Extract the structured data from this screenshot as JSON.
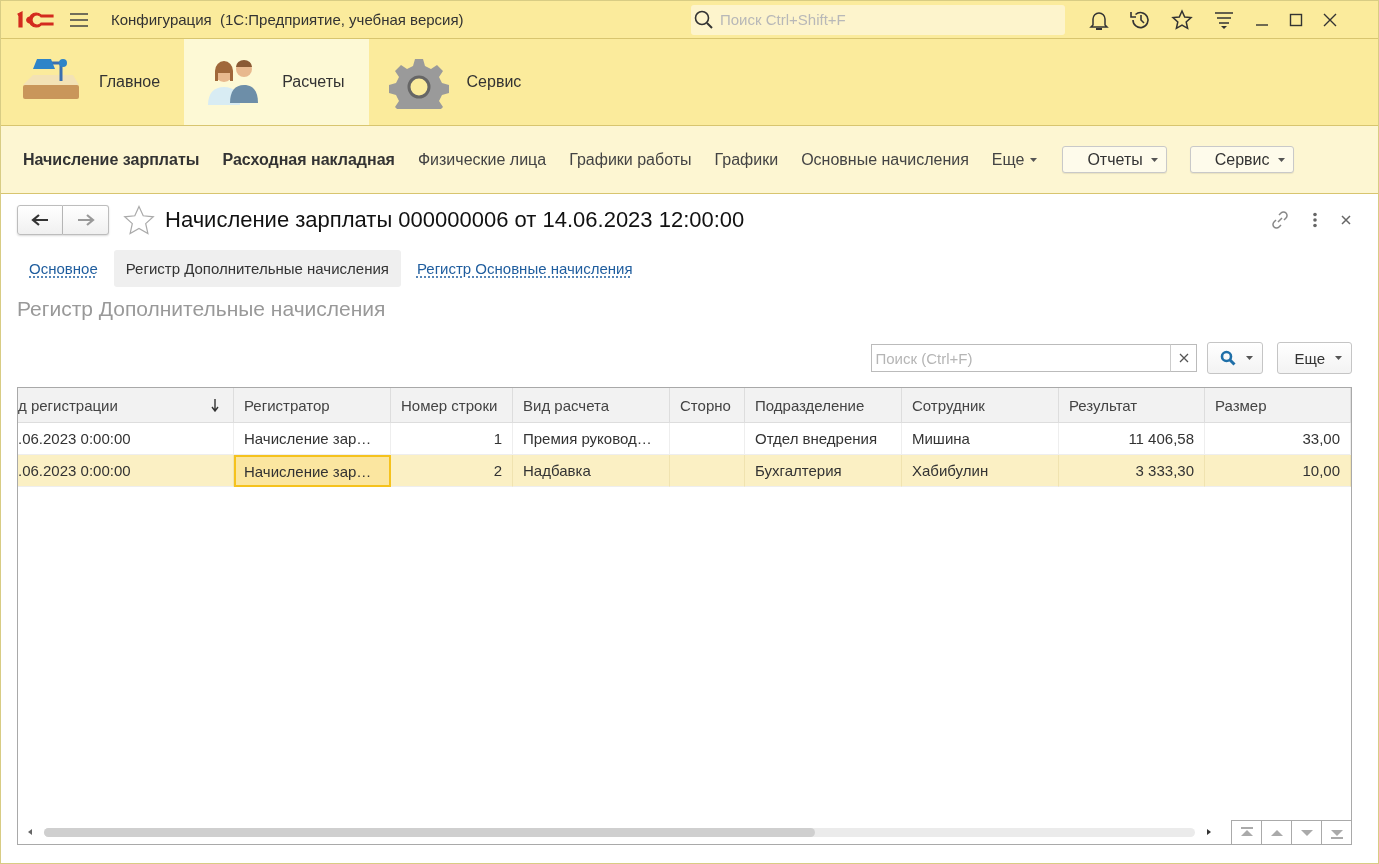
{
  "window": {
    "title": "Конфигурация  (1С:Предприятие, учебная версия)",
    "search": {
      "placeholder": "Поиск Ctrl+Shift+F"
    }
  },
  "sections": [
    {
      "label": "Главное",
      "kind": "lamp",
      "selected": false
    },
    {
      "label": "Расчеты",
      "kind": "people",
      "selected": true
    },
    {
      "label": "Сервис",
      "kind": "gear",
      "selected": false
    }
  ],
  "commands": [
    {
      "label": "Начисление зарплаты",
      "kind": "link",
      "important": true
    },
    {
      "label": "Расходная накладная",
      "kind": "link",
      "important": true
    },
    {
      "label": "Физические лица",
      "kind": "link",
      "important": false
    },
    {
      "label": "Графики работы",
      "kind": "link",
      "important": false
    },
    {
      "label": "Графики",
      "kind": "link",
      "important": false
    },
    {
      "label": "Основные начисления",
      "kind": "link",
      "important": false
    },
    {
      "label": "Еще",
      "kind": "menu"
    },
    {
      "label": "Отчеты",
      "kind": "button"
    },
    {
      "label": "Сервис",
      "kind": "button"
    }
  ],
  "document": {
    "title": "Начисление зарплаты 000000006 от 14.06.2023 12:00:00",
    "tabs": [
      {
        "label": "Основное",
        "selected": false
      },
      {
        "label": "Регистр Дополнительные начисления",
        "selected": true
      },
      {
        "label": "Регистр Основные начисления",
        "selected": false
      }
    ],
    "section_title": "Регистр Дополнительные начисления",
    "search": {
      "placeholder": "Поиск (Ctrl+F)"
    },
    "more_button": "Еще",
    "table": {
      "columns": [
        {
          "label": "д регистрации",
          "kind": "text",
          "sorted": true
        },
        {
          "label": "Регистратор",
          "kind": "text",
          "sorted": false
        },
        {
          "label": "Номер строки",
          "kind": "number",
          "sorted": false
        },
        {
          "label": "Вид расчета",
          "kind": "text",
          "sorted": false
        },
        {
          "label": "Сторно",
          "kind": "text",
          "sorted": false
        },
        {
          "label": "Подразделение",
          "kind": "text",
          "sorted": false
        },
        {
          "label": "Сотрудник",
          "kind": "text",
          "sorted": false
        },
        {
          "label": "Результат",
          "kind": "number",
          "sorted": false
        },
        {
          "label": "Размер",
          "kind": "number",
          "sorted": false
        }
      ],
      "rows": [
        {
          "selected": false,
          "cells": [
            {
              "text": ".06.2023 0:00:00",
              "focused": false
            },
            {
              "text": "Начисление зар…",
              "focused": false
            },
            {
              "text": "1",
              "focused": false
            },
            {
              "text": "Премия руковод…",
              "focused": false
            },
            {
              "focused": false
            },
            {
              "text": "Отдел внедрения",
              "focused": false
            },
            {
              "text": "Мишина",
              "focused": false
            },
            {
              "text": "11 406,58",
              "focused": false
            },
            {
              "text": "33,00",
              "focused": false
            }
          ]
        },
        {
          "selected": true,
          "cells": [
            {
              "text": ".06.2023 0:00:00",
              "focused": false
            },
            {
              "text": "Начисление зар…",
              "focused": true
            },
            {
              "text": "2",
              "focused": false
            },
            {
              "text": "Надбавка",
              "focused": false
            },
            {
              "focused": false
            },
            {
              "text": "Бухгалтерия",
              "focused": false
            },
            {
              "text": "Хабибулин",
              "focused": false
            },
            {
              "text": "3 333,30",
              "focused": false
            },
            {
              "text": "10,00",
              "focused": false
            }
          ]
        }
      ]
    }
  }
}
